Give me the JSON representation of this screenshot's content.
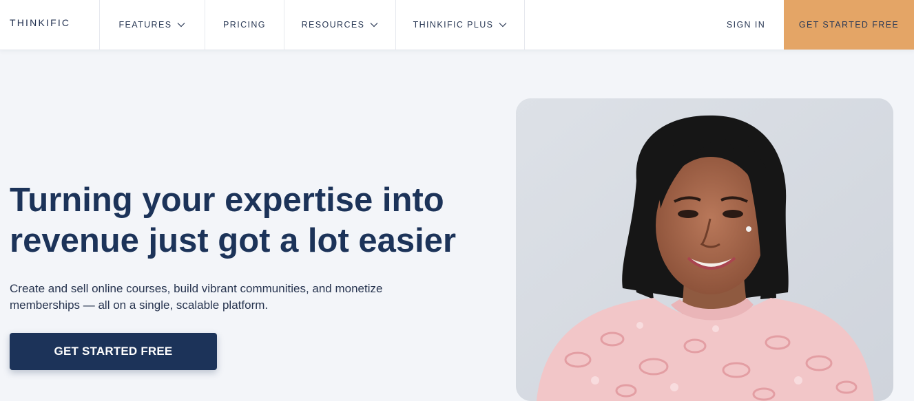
{
  "header": {
    "logo": "THINKIFIC",
    "nav": [
      {
        "label": "FEATURES",
        "has_dropdown": true
      },
      {
        "label": "PRICING",
        "has_dropdown": false
      },
      {
        "label": "RESOURCES",
        "has_dropdown": true
      },
      {
        "label": "THINKIFIC PLUS",
        "has_dropdown": true
      }
    ],
    "sign_in": "SIGN IN",
    "cta": "GET STARTED FREE"
  },
  "hero": {
    "headline_line1": "Turning your expertise into",
    "headline_line2": "revenue just got a lot easier",
    "subtitle_line1": "Create and sell online courses, build vibrant communities, and monetize",
    "subtitle_line2": "memberships — all on a single, scalable platform.",
    "cta": "GET STARTED FREE"
  },
  "colors": {
    "navy": "#1c3359",
    "accent_orange": "#e4a566",
    "page_bg": "#f3f5f9",
    "photo_bg": "#d9dde4"
  },
  "icons": {
    "dropdown": "chevron-down-icon"
  }
}
